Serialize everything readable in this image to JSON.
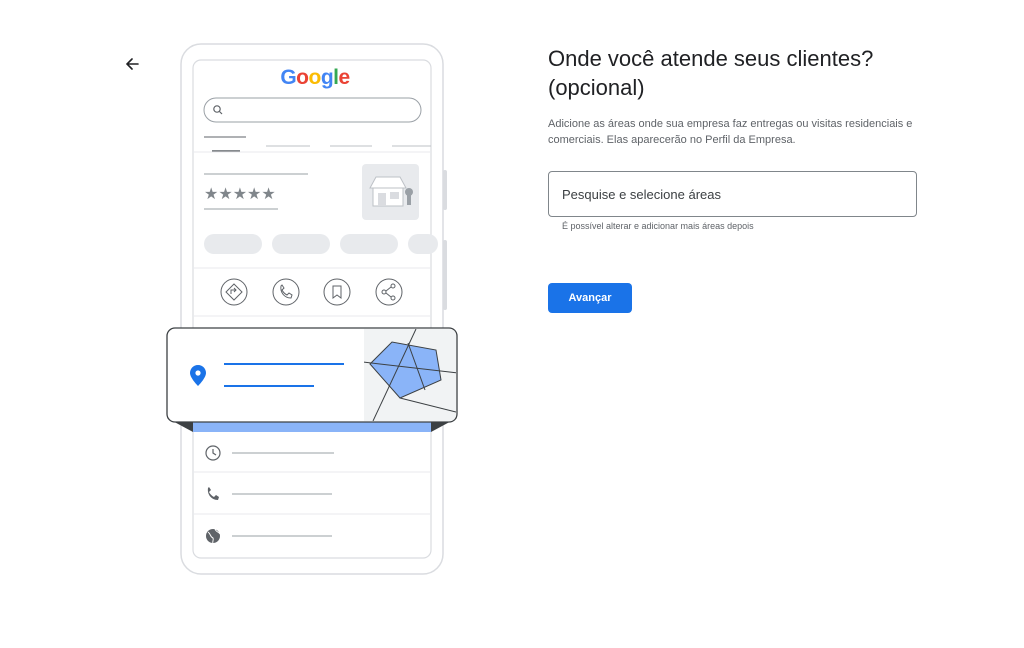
{
  "header": {
    "back_icon": "arrow-back-icon"
  },
  "illustration": {
    "logo_text": "Google",
    "logo_letters": [
      {
        "char": "G",
        "color": "#4285f4"
      },
      {
        "char": "o",
        "color": "#ea4335"
      },
      {
        "char": "o",
        "color": "#fbbc05"
      },
      {
        "char": "g",
        "color": "#4285f4"
      },
      {
        "char": "l",
        "color": "#34a853"
      },
      {
        "char": "e",
        "color": "#ea4335"
      }
    ],
    "rating_stars": "★★★★★",
    "action_icons": [
      "directions-icon",
      "phone-icon",
      "bookmark-icon",
      "share-icon"
    ],
    "detail_icons": [
      "clock-icon",
      "phone-icon",
      "globe-icon"
    ]
  },
  "form": {
    "title": "Onde você atende seus clientes? (opcional)",
    "description": "Adicione as áreas onde sua empresa faz entregas ou visitas residenciais e comerciais. Elas aparecerão no Perfil da Empresa.",
    "search_placeholder": "Pesquise e selecione áreas",
    "helper_text": "É possível alterar e adicionar mais áreas depois",
    "next_label": "Avançar"
  },
  "colors": {
    "accent": "#1a73e8",
    "map_area": "#8ab4f8",
    "pin": "#1a73e8"
  }
}
